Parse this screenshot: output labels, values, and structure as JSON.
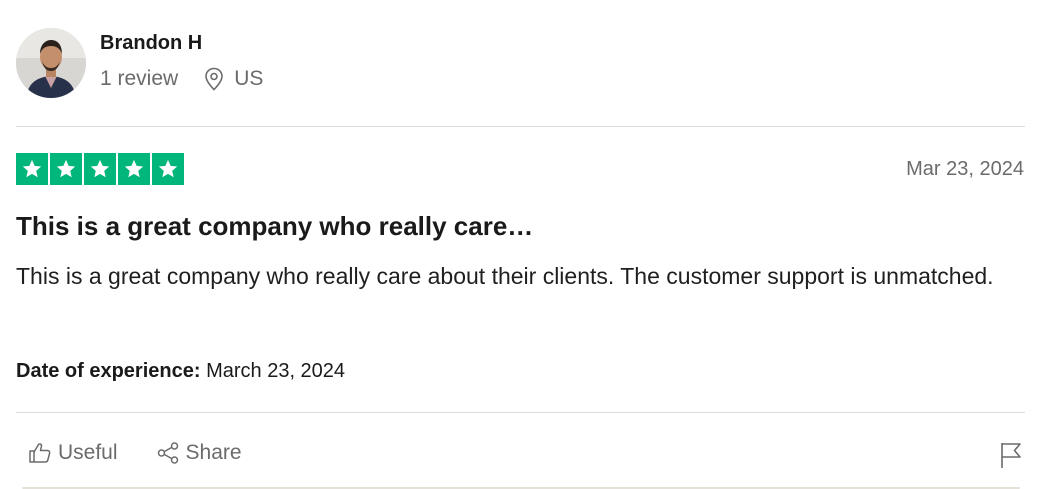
{
  "reviewer": {
    "name": "Brandon H",
    "review_count": "1 review",
    "location": "US",
    "avatar_icon": "person-photo-avatar"
  },
  "review": {
    "rating": 5,
    "rating_max": 5,
    "star_color": "#00b67a",
    "date": "Mar 23, 2024",
    "title": "This is a great company who really care…",
    "text": "This is a great company who really care about their clients. The customer support is unmatched.",
    "experience_label": "Date of experience:",
    "experience_date": "March 23, 2024"
  },
  "actions": {
    "useful_label": "Useful",
    "useful_icon": "thumbs-up-icon",
    "share_label": "Share",
    "share_icon": "share-icon",
    "report_icon": "flag-icon"
  }
}
